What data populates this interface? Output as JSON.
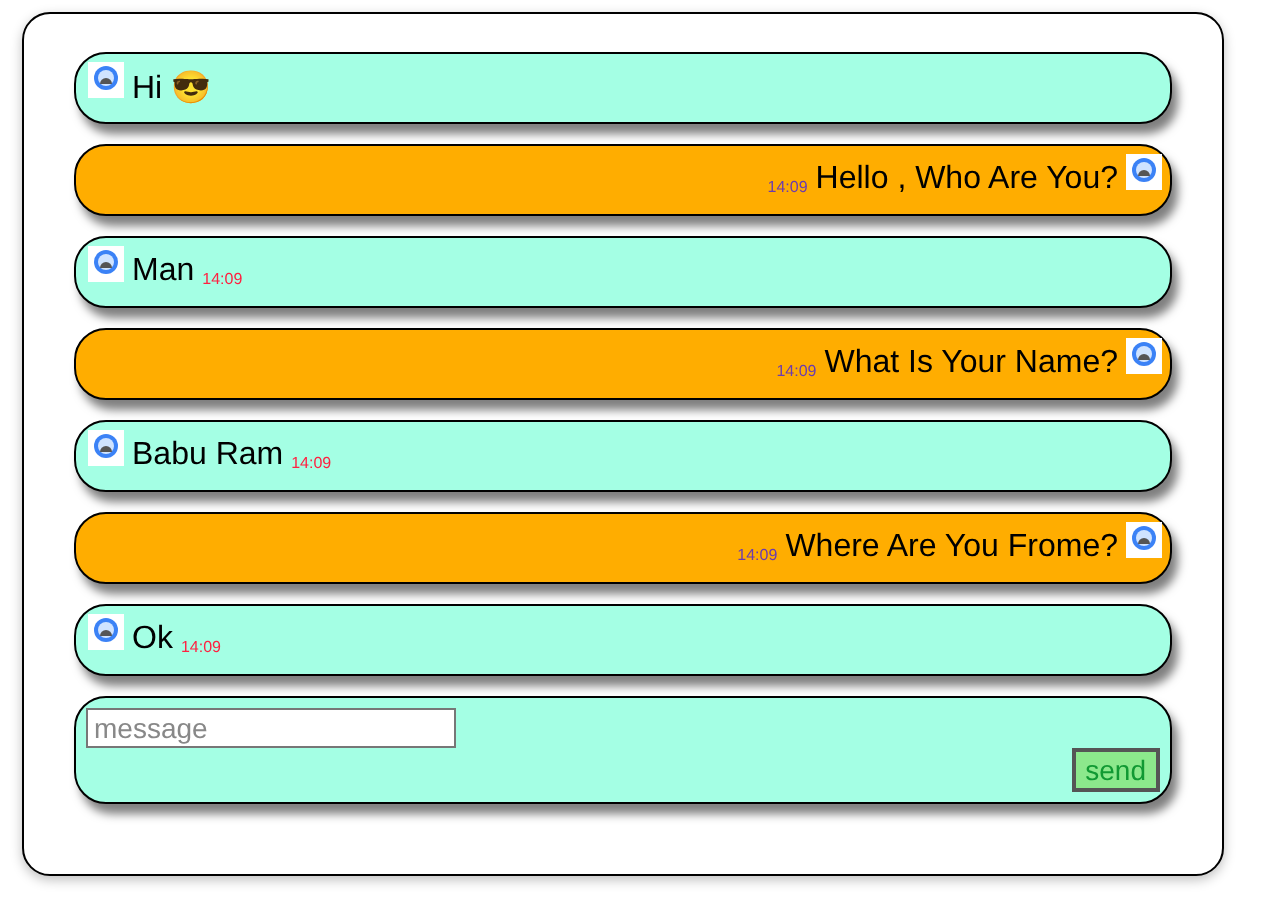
{
  "messages": [
    {
      "kind": "received",
      "text": "Hi 😎"
    },
    {
      "kind": "sent",
      "text": "Hello , Who Are You?",
      "time": "14:09"
    },
    {
      "kind": "received",
      "text": "Man",
      "time": "14:09"
    },
    {
      "kind": "sent",
      "text": "What Is Your Name?",
      "time": "14:09"
    },
    {
      "kind": "received",
      "text": "Babu Ram",
      "time": "14:09"
    },
    {
      "kind": "sent",
      "text": "Where Are You Frome?",
      "time": "14:09"
    },
    {
      "kind": "received",
      "text": "Ok",
      "time": "14:09"
    }
  ],
  "composer": {
    "placeholder": "message",
    "button": "send"
  }
}
